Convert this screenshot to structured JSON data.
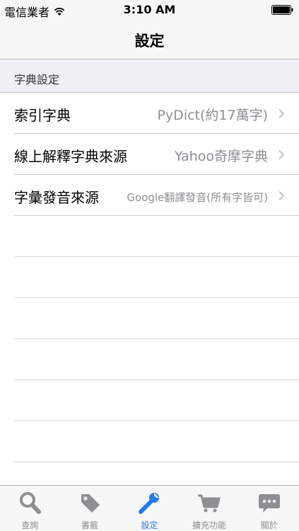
{
  "status_bar": {
    "carrier": "電信業者",
    "time": "3:10 AM"
  },
  "nav": {
    "title": "設定"
  },
  "section": {
    "title": "字典設定"
  },
  "rows": [
    {
      "label": "索引字典",
      "value": "PyDict(約17萬字)"
    },
    {
      "label": "線上解釋字典來源",
      "value": "Yahoo奇摩字典"
    },
    {
      "label": "字彙發音來源",
      "value": "Google翻譯發音(所有字皆可)"
    }
  ],
  "tabs": [
    {
      "label": "查詢",
      "icon": "magnifier-icon"
    },
    {
      "label": "書籤",
      "icon": "tag-icon"
    },
    {
      "label": "設定",
      "icon": "wrench-icon"
    },
    {
      "label": "擴充功能",
      "icon": "cart-icon"
    },
    {
      "label": "關於",
      "icon": "chat-bubble-icon"
    }
  ],
  "colors": {
    "accent": "#1f7bf6",
    "inactive": "#8e8e93",
    "secondary_text": "#8e8e93"
  }
}
